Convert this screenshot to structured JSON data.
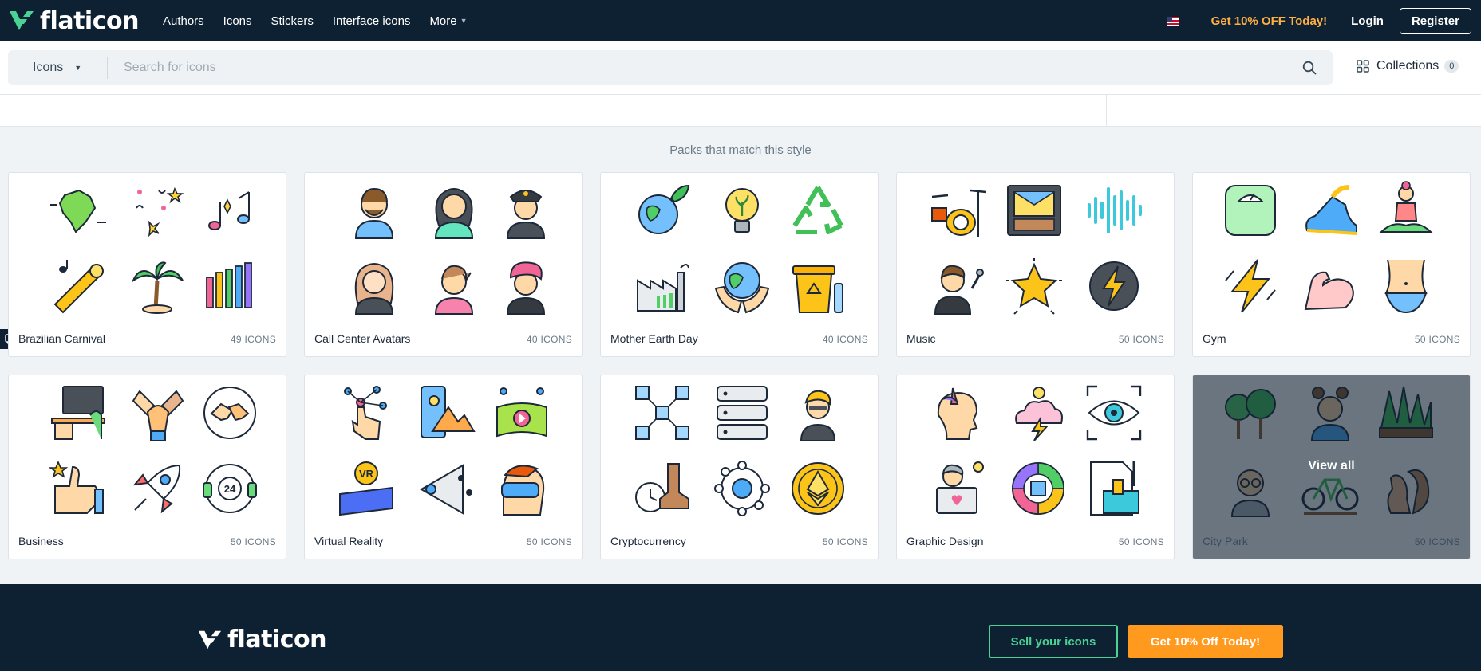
{
  "brand": {
    "name": "flaticon"
  },
  "nav": {
    "links": [
      "Authors",
      "Icons",
      "Stickers",
      "Interface icons",
      "More"
    ],
    "promo": "Get 10% OFF Today!",
    "login": "Login",
    "register": "Register"
  },
  "search": {
    "type_value": "Icons",
    "placeholder": "Search for icons",
    "collections_label": "Collections",
    "collections_count": "0"
  },
  "section": {
    "title": "Packs that match this style"
  },
  "packs": [
    {
      "name": "Brazilian Carnival",
      "count": "49 ICONS"
    },
    {
      "name": "Call Center Avatars",
      "count": "40 ICONS"
    },
    {
      "name": "Mother Earth Day",
      "count": "40 ICONS"
    },
    {
      "name": "Music",
      "count": "50 ICONS"
    },
    {
      "name": "Gym",
      "count": "50 ICONS"
    },
    {
      "name": "Business",
      "count": "50 ICONS"
    },
    {
      "name": "Virtual Reality",
      "count": "50 ICONS"
    },
    {
      "name": "Cryptocurrency",
      "count": "50 ICONS"
    },
    {
      "name": "Graphic Design",
      "count": "50 ICONS"
    },
    {
      "name": "City Park",
      "count": "50 ICONS",
      "overlay_label": "View all"
    }
  ],
  "footer": {
    "sell_label": "Sell your icons",
    "promo_label": "Get 10% Off Today!"
  },
  "colors": {
    "nav_bg": "#0e2132",
    "brand_green": "#4ad295",
    "promo_orange": "#ffb043",
    "cta_orange": "#ff9a1f"
  }
}
